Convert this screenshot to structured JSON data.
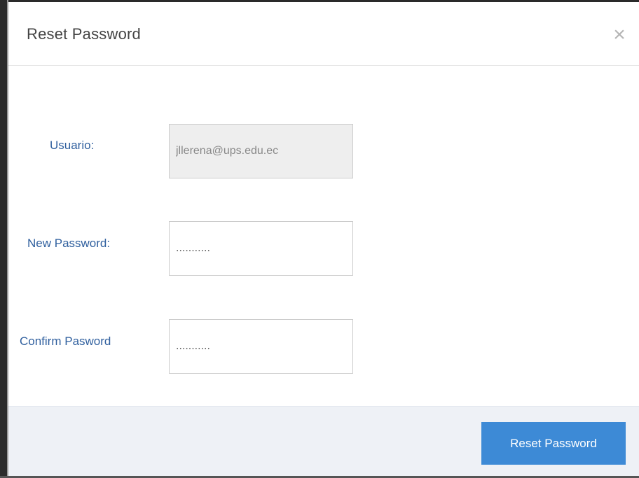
{
  "dialog": {
    "title": "Reset Password",
    "close_glyph": "×"
  },
  "form": {
    "usuario_label": "Usuario:",
    "usuario_value": "jllerena@ups.edu.ec",
    "new_password_label": "New Password:",
    "new_password_value": "...........",
    "confirm_password_label": "Confirm Pasword",
    "confirm_password_value": "..........."
  },
  "footer": {
    "submit_label": "Reset Password"
  },
  "icons": {
    "close": "close-icon"
  },
  "colors": {
    "label_blue": "#2f5f9e",
    "primary_button": "#3d8ad6",
    "footer_bg": "#eef1f6"
  }
}
